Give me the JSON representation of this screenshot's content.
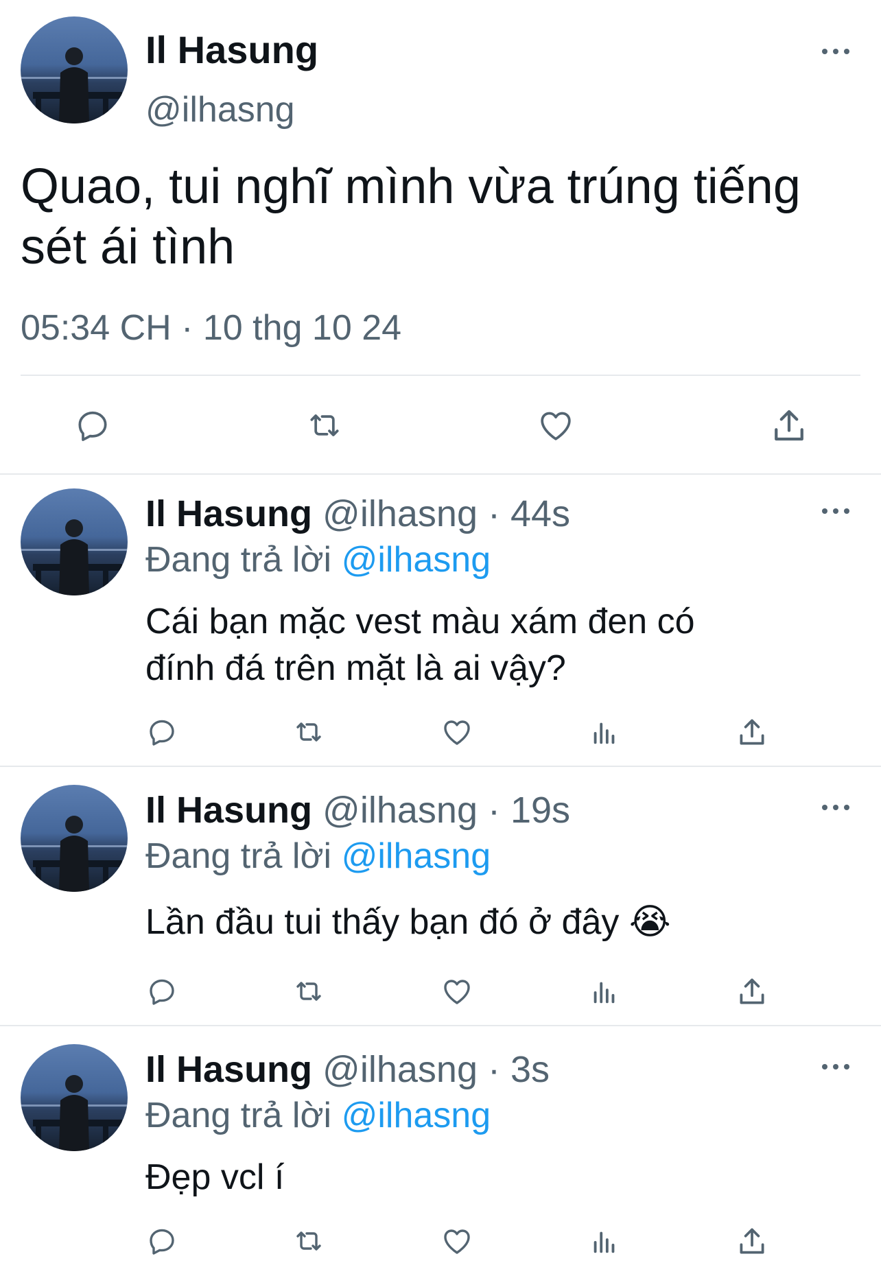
{
  "main_tweet": {
    "display_name": "Il Hasung",
    "handle": "@ilhasng",
    "text_line1": "Quao, tui nghĩ mình vừa trúng tiếng",
    "text_line2": "sét ái tình",
    "timestamp": "05:34 CH · 10 thg 10 24"
  },
  "replies": [
    {
      "display_name": "Il Hasung",
      "handle_time": "@ilhasng · 44s",
      "replying_label": "Đang trả lời",
      "replying_to": "@ilhasng",
      "text_line1": "Cái bạn mặc vest màu xám đen có",
      "text_line2": "đính đá trên mặt là ai vậy?"
    },
    {
      "display_name": "Il Hasung",
      "handle_time": "@ilhasng · 19s",
      "replying_label": "Đang trả lời",
      "replying_to": "@ilhasng",
      "text_line1": "Lần đầu tui thấy bạn đó ở đây 😭"
    },
    {
      "display_name": "Il Hasung",
      "handle_time": "@ilhasng · 3s",
      "replying_label": "Đang trả lời",
      "replying_to": "@ilhasng",
      "text_line1": "Đẹp vcl í"
    }
  ],
  "colors": {
    "text": "#0f1419",
    "muted": "#536471",
    "link": "#1d9bf0",
    "divider": "#e6e9ec"
  },
  "icons": [
    "reply-icon",
    "retweet-icon",
    "like-icon",
    "views-icon",
    "share-icon",
    "more-icon"
  ]
}
